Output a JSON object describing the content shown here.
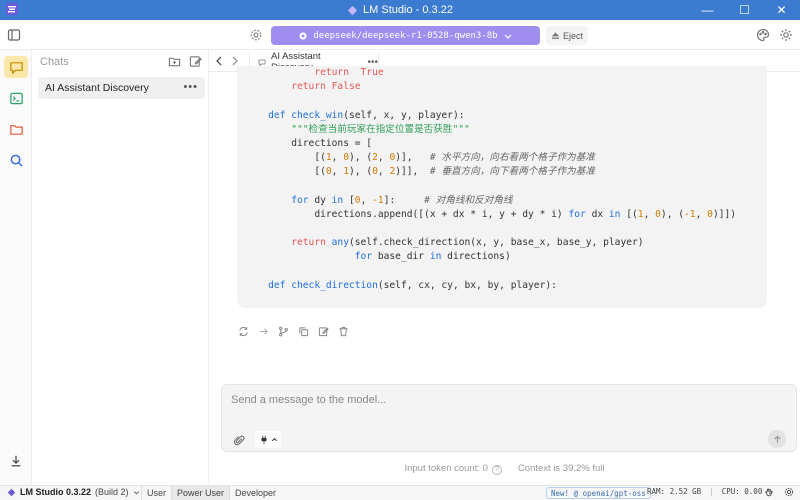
{
  "window": {
    "title": "LM Studio - 0.3.22",
    "minimize": "—",
    "maximize": "☐",
    "close": "✕"
  },
  "toolbar": {
    "model_name": "deepseek/deepseek-r1-0528-qwen3-8b",
    "eject_label": "Eject",
    "model_pill_color": "#9f8ef0"
  },
  "rail": {
    "items": [
      "chat-icon",
      "terminal-icon",
      "folder-icon",
      "search-icon"
    ],
    "active": "chat-icon",
    "active_color": "#fbe7a8"
  },
  "sidebar": {
    "header": "Chats",
    "chats": [
      {
        "title": "AI Assistant Discovery",
        "menu": "•••"
      }
    ]
  },
  "tabs": [
    {
      "title": "AI Assistant Discovery",
      "menu": "•••"
    }
  ],
  "code": {
    "lines": [
      [
        [
          "pad",
          "            "
        ],
        [
          "kr",
          "return"
        ],
        [
          "",
          "  "
        ],
        [
          "kr",
          "True"
        ]
      ],
      [
        [
          "pad",
          "        "
        ],
        [
          "kr",
          "return"
        ],
        [
          "",
          " "
        ],
        [
          "kr",
          "False"
        ]
      ],
      [
        [
          "",
          ""
        ]
      ],
      [
        [
          "pad",
          "    "
        ],
        [
          "kw",
          "def"
        ],
        [
          "",
          " "
        ],
        [
          "fn",
          "check_win"
        ],
        [
          "",
          "(self, x, y, player):"
        ]
      ],
      [
        [
          "pad",
          "        "
        ],
        [
          "str",
          "\"\"\"检查当前玩家在指定位置是否获胜\"\"\""
        ]
      ],
      [
        [
          "pad",
          "        "
        ],
        [
          "",
          "directions = ["
        ]
      ],
      [
        [
          "pad",
          "            "
        ],
        [
          "",
          "[("
        ],
        [
          "num",
          "1"
        ],
        [
          "",
          ", "
        ],
        [
          "num",
          "0"
        ],
        [
          "",
          "), ("
        ],
        [
          "num",
          "2"
        ],
        [
          "",
          ", "
        ],
        [
          "num",
          "0"
        ],
        [
          "",
          ")],   "
        ],
        [
          "cm",
          "# 水平方向，向右看两个格子作为基准"
        ]
      ],
      [
        [
          "pad",
          "            "
        ],
        [
          "",
          "[("
        ],
        [
          "num",
          "0"
        ],
        [
          "",
          ", "
        ],
        [
          "num",
          "1"
        ],
        [
          "",
          "), ("
        ],
        [
          "num",
          "0"
        ],
        [
          "",
          ", "
        ],
        [
          "num",
          "2"
        ],
        [
          "",
          ")]],  "
        ],
        [
          "cm",
          "# 垂直方向，向下看两个格子作为基准"
        ]
      ],
      [
        [
          "",
          ""
        ]
      ],
      [
        [
          "pad",
          "        "
        ],
        [
          "kw",
          "for"
        ],
        [
          "",
          " dy "
        ],
        [
          "kw",
          "in"
        ],
        [
          "",
          " ["
        ],
        [
          "num",
          "0"
        ],
        [
          "",
          ", "
        ],
        [
          "num",
          "-1"
        ],
        [
          "",
          "]:     "
        ],
        [
          "cm",
          "# 对角线和反对角线"
        ]
      ],
      [
        [
          "pad",
          "            "
        ],
        [
          "",
          "directions.append([(x + dx * i, y + dy * i) "
        ],
        [
          "kw",
          "for"
        ],
        [
          "",
          " dx "
        ],
        [
          "kw",
          "in"
        ],
        [
          "",
          " [("
        ],
        [
          "num",
          "1"
        ],
        [
          "",
          ", "
        ],
        [
          "num",
          "0"
        ],
        [
          "",
          "), ("
        ],
        [
          "num",
          "-1"
        ],
        [
          "",
          ", "
        ],
        [
          "num",
          "0"
        ],
        [
          "",
          ")]])"
        ]
      ],
      [
        [
          "",
          ""
        ]
      ],
      [
        [
          "pad",
          "        "
        ],
        [
          "kr",
          "return"
        ],
        [
          "",
          " "
        ],
        [
          "kb",
          "any"
        ],
        [
          "",
          "(self.check_direction(x, y, base_x, base_y, player)"
        ]
      ],
      [
        [
          "pad",
          "                   "
        ],
        [
          "kw",
          "for"
        ],
        [
          "",
          " base_dir "
        ],
        [
          "kw",
          "in"
        ],
        [
          "",
          " directions)"
        ]
      ],
      [
        [
          "",
          ""
        ]
      ],
      [
        [
          "pad",
          "    "
        ],
        [
          "kw",
          "def"
        ],
        [
          "",
          " "
        ],
        [
          "fn",
          "check_direction"
        ],
        [
          "",
          "(self, cx, cy, bx, by, player):"
        ]
      ]
    ]
  },
  "message_actions": [
    "regenerate-icon",
    "continue-icon",
    "branch-icon",
    "copy-icon",
    "edit-icon",
    "delete-icon"
  ],
  "composer": {
    "placeholder": "Send a message to the model..."
  },
  "footer": {
    "input_tokens": "Input token count:  0",
    "context": "Context is 39.2% full"
  },
  "statusbar": {
    "app_name": "LM Studio 0.3.22",
    "build": "(Build 2)",
    "modes": [
      "User",
      "Power User",
      "Developer"
    ],
    "selected_mode": "Power User",
    "news": "New! @ openai/gpt-oss",
    "ram": "RAM: 2.52 GB",
    "cpu": "CPU: 0.00 %"
  }
}
